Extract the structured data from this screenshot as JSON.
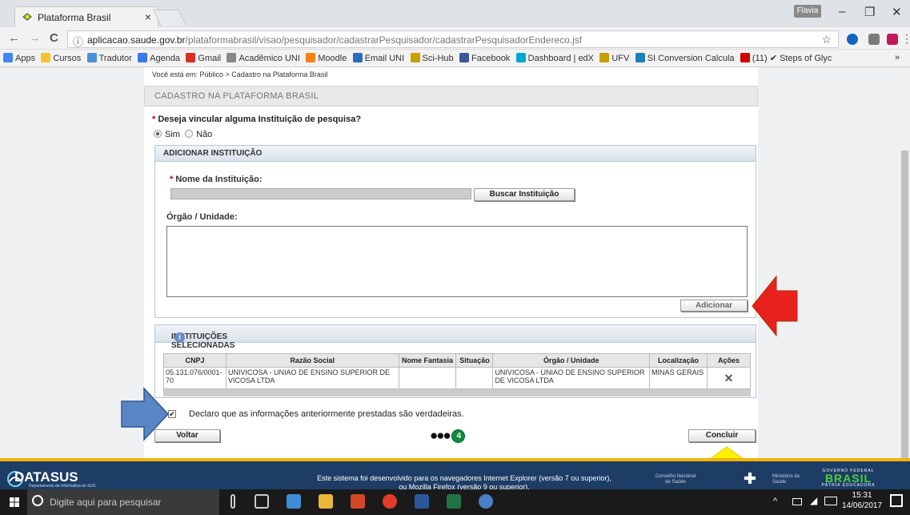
{
  "browser": {
    "tab_title": "Plataforma Brasil",
    "tab_close": "×",
    "user_badge": "Flavia",
    "window_controls": [
      "–",
      "❐",
      "✕"
    ],
    "back": "←",
    "forward": "→",
    "reload": "C",
    "url_host": "aplicacao.saude.gov.br",
    "url_path": "/plataformabrasil/visao/pesquisador/cadastrarPesquisador/cadastrarPesquisadorEndereco.jsf",
    "bookmarks": [
      {
        "label": "Apps",
        "color": "#4285f4"
      },
      {
        "label": "Cursos",
        "color": "#f4c430"
      },
      {
        "label": "Tradutor",
        "color": "#4a90d9"
      },
      {
        "label": "Agenda",
        "color": "#3b78e7"
      },
      {
        "label": "Gmail",
        "color": "#d93025"
      },
      {
        "label": "Acadêmico UNI",
        "color": "#888888"
      },
      {
        "label": "Moodle",
        "color": "#f98012"
      },
      {
        "label": "Email UNI",
        "color": "#2a6ebb"
      },
      {
        "label": "Sci-Hub",
        "color": "#c8a000"
      },
      {
        "label": "Facebook",
        "color": "#3b5998"
      },
      {
        "label": "Dashboard | edX",
        "color": "#02a6d6"
      },
      {
        "label": "UFV",
        "color": "#c8a000"
      },
      {
        "label": "SI Conversion Calcula",
        "color": "#1b7fbd"
      },
      {
        "label": "(11) ✔ Steps of Glyc",
        "color": "#cc0000"
      }
    ],
    "bookmarks_more": "»"
  },
  "page": {
    "breadcrumb": "Você está em: Público > Cadastro na Plataforma Brasil",
    "header": "CADASTRO NA PLATAFORMA BRASIL",
    "question": "Deseja vincular alguma Instituição de pesquisa?",
    "required_mark": "*",
    "radio_yes": "Sim",
    "radio_no": "Não",
    "selected_option": "Sim",
    "add_panel_title": "ADICIONAR INSTITUIÇÃO",
    "institution_label": "Nome da Instituição:",
    "search_button": "Buscar Instituição",
    "org_label": "Órgão / Unidade:",
    "add_button": "Adicionar",
    "selected_panel_title": "INSTITUIÇÕES SELECIONADAS",
    "info_icon": "i",
    "table": {
      "headers": [
        "CNPJ",
        "Razão Social",
        "Nome Fantasia",
        "Situação",
        "Órgão / Unidade",
        "Localização",
        "Ações"
      ],
      "rows": [
        [
          "05.131.076/0001-70",
          "UNIVICOSA - UNIAO DE ENSINO SUPERIOR DE VICOSA LTDA",
          "",
          "",
          "UNIVICOSA - UNIAO DE ENSINO SUPERIOR DE VICOSA LTDA",
          "MINAS GERAIS",
          "✕"
        ]
      ]
    },
    "declaration": "Declaro que as informações anteriormente prestadas são verdadeiras.",
    "declaration_checked": true,
    "back_button": "Voltar",
    "finish_button": "Concluir",
    "step_dots": "●●●",
    "current_step": "4"
  },
  "footer": {
    "logo": "DATASUS",
    "logo_sub": "Departamento de Informática do SUS",
    "text_line1": "Este sistema foi desenvolvido para os navegadores Internet Explorer (versão 7 ou superior),",
    "text_line2": "ou Mozilla Firefox (versão 9 ou superior).",
    "cns": "Conselho Nacional de Saúde",
    "ministry": "Ministério da Saúde",
    "gov_top": "GOVERNO FEDERAL",
    "brasil": "BRASIL",
    "gov_bottom": "PÁTRIA EDUCADORA"
  },
  "taskbar": {
    "search_placeholder": "Digite aqui para pesquisar",
    "time": "15:31",
    "date": "14/06/2017"
  }
}
